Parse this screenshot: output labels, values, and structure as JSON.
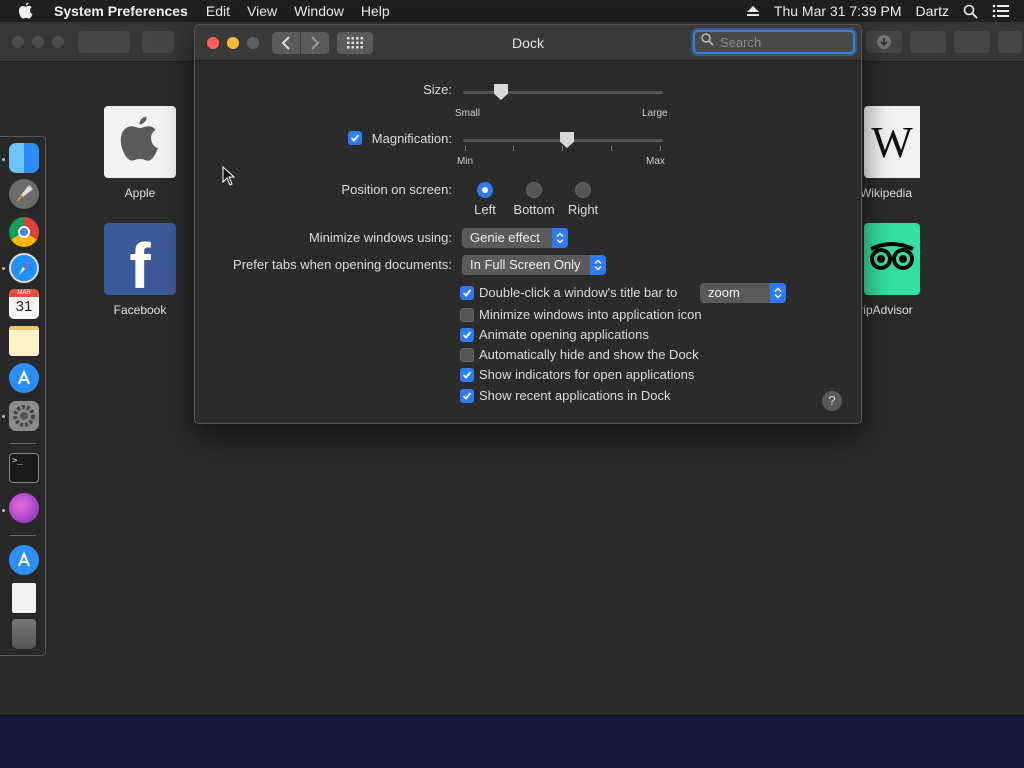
{
  "menubar": {
    "app_name": "System Preferences",
    "menus": [
      "Edit",
      "View",
      "Window",
      "Help"
    ],
    "datetime": "Thu Mar 31  7:39 PM",
    "user": "Dartz"
  },
  "favorites": [
    {
      "label": "Apple",
      "icon": "apple-logo-icon"
    },
    {
      "label": "Facebook",
      "icon": "facebook-logo-icon"
    },
    {
      "label": "Wikipedia",
      "icon": "wikipedia-logo-icon"
    },
    {
      "label": "ripAdvisor",
      "icon": "tripadvisor-logo-icon"
    }
  ],
  "dock_apps": [
    "finder-icon",
    "launchpad-icon",
    "chrome-icon",
    "safari-icon",
    "calendar-icon",
    "notes-icon",
    "app-store-icon",
    "system-preferences-icon",
    "terminal-icon",
    "app-icon",
    "app-store-icon",
    "document-icon",
    "trash-icon"
  ],
  "calendar": {
    "month": "MAR",
    "day": "31"
  },
  "window": {
    "title": "Dock",
    "search_placeholder": "Search"
  },
  "size": {
    "label": "Size:",
    "min_label": "Small",
    "max_label": "Large",
    "value": 0.19
  },
  "magnification": {
    "label": "Magnification:",
    "checked": true,
    "min_label": "Min",
    "max_label": "Max",
    "value": 0.52
  },
  "position": {
    "label": "Position on screen:",
    "options": [
      "Left",
      "Bottom",
      "Right"
    ],
    "selected": "Left"
  },
  "minimize": {
    "label": "Minimize windows using:",
    "value": "Genie effect"
  },
  "tabs": {
    "label": "Prefer tabs when opening documents:",
    "value": "In Full Screen Only"
  },
  "options": [
    {
      "label": "Double-click a window's title bar to",
      "checked": true
    },
    {
      "label": "Minimize windows into application icon",
      "checked": false
    },
    {
      "label": "Animate opening applications",
      "checked": true
    },
    {
      "label": "Automatically hide and show the Dock",
      "checked": false
    },
    {
      "label": "Show indicators for open applications",
      "checked": true
    },
    {
      "label": "Show recent applications in Dock",
      "checked": true
    }
  ],
  "titlebar_action": "zoom",
  "help_label": "?",
  "colors": {
    "accent": "#2f7bf5",
    "window": "#2b2b2b"
  }
}
